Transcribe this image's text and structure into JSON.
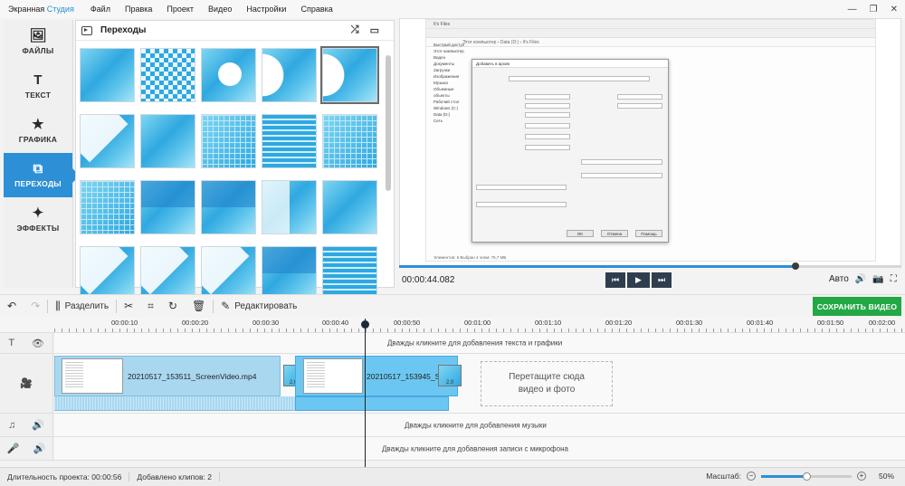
{
  "app": {
    "title_part1": "Экранная ",
    "title_part2": "Студия"
  },
  "menu": [
    "Файл",
    "Правка",
    "Проект",
    "Видео",
    "Настройки",
    "Справка"
  ],
  "window_controls": [
    "—",
    "❐",
    "✕"
  ],
  "nav": [
    {
      "label": "ФАЙЛЫ",
      "icon": "🖼"
    },
    {
      "label": "ТЕКСТ",
      "icon": "T"
    },
    {
      "label": "ГРАФИКА",
      "icon": "★"
    },
    {
      "label": "ПЕРЕХОДЫ",
      "icon": "⧉"
    },
    {
      "label": "ЭФФЕКТЫ",
      "icon": "✦"
    }
  ],
  "panel": {
    "title": "Переходы",
    "shuffle_icon": "⤮",
    "filmstrip_icon": "▭"
  },
  "preview": {
    "explorer_title": "It's Files",
    "explorer_path": "Этот компьютер › Data (D:) › It's Files",
    "explorer_sidebar": [
      "Быстрый доступ",
      "Этот компьютер",
      "Видео",
      "Документы",
      "Загрузки",
      "Изображения",
      "Музыка",
      "Объемные объекты",
      "Рабочий стол",
      "Windows (C:)",
      "Data (D:)",
      "Сеть"
    ],
    "dialog_title": "Добавить в архив",
    "dialog_ok": "OK",
    "dialog_cancel": "Отмена",
    "dialog_help": "Помощь",
    "explorer_status": "Элементов: 6    Выбран 4 элем: 75,7 МБ"
  },
  "player": {
    "timecode": "00:00:44.082",
    "auto_label": "Авто",
    "progress": 0.79
  },
  "toolbar": {
    "split": "Разделить",
    "edit": "Редактировать",
    "save": "СОХРАНИТЬ ВИДЕО"
  },
  "ruler": [
    "00:00:10",
    "00:00:20",
    "00:00:30",
    "00:00:40",
    "00:00:50",
    "00:01:00",
    "00:01:10",
    "00:01:20",
    "00:01:30",
    "00:01:40",
    "00:01:50",
    "00:02:00"
  ],
  "tracks": {
    "text_hint": "Дважды кликните для добавления текста и графики",
    "music_hint": "Дважды кликните для добавления музыки",
    "mic_hint": "Дважды кликните для добавления записи с микрофона",
    "clip1_name": "20210517_153511_ScreenVideo.mp4",
    "clip2_name": "20210517_153945_Sc",
    "transition_duration": "2.0",
    "drop_zone_line1": "Перетащите сюда",
    "drop_zone_line2": "видео и фото"
  },
  "status": {
    "duration": "Длительность проекта: 00:00:56",
    "clips": "Добавлено клипов: 2",
    "zoom_label": "Масштаб:",
    "zoom_value": "50%",
    "zoom_level": 0.5
  }
}
